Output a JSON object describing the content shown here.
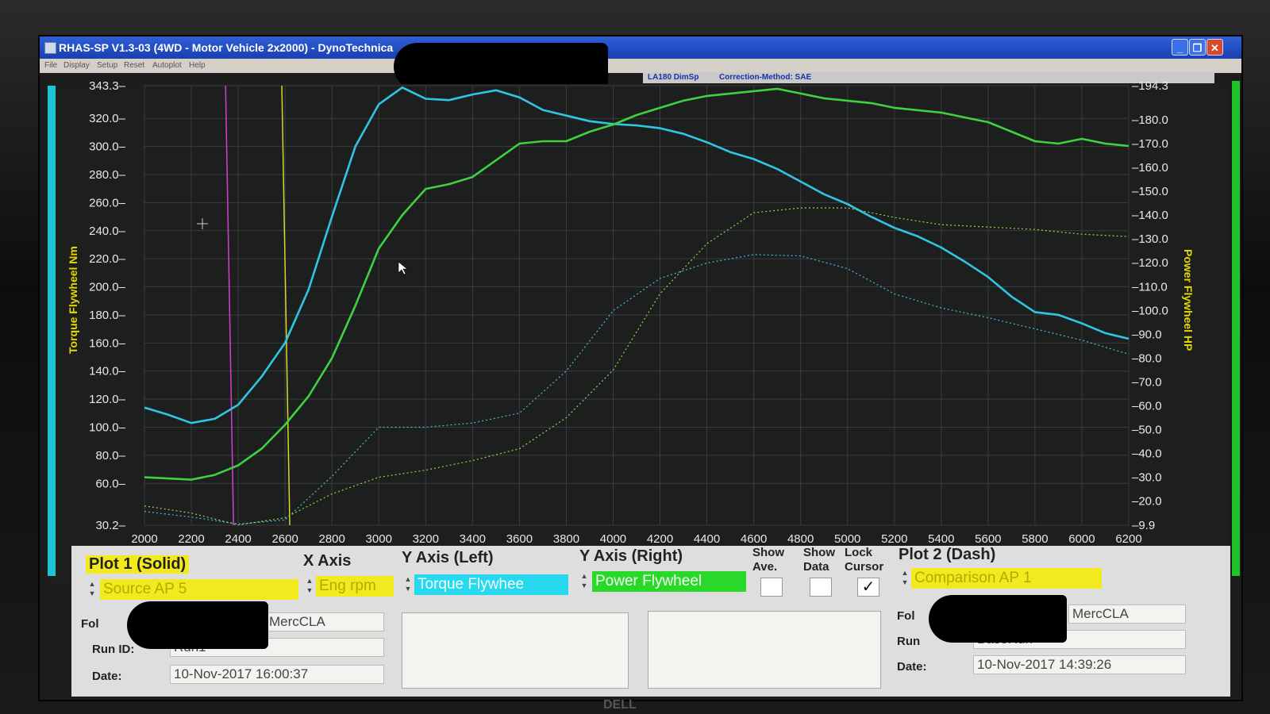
{
  "window": {
    "title": "RHAS-SP V1.3-03  (4WD - Motor Vehicle 2x2000) - DynoTechnica",
    "buttons": {
      "minimize": "_",
      "maximize": "❐",
      "close": "✕"
    }
  },
  "menu": [
    "File",
    "Display",
    "Setup",
    "Reset",
    "Autoplot",
    "Help"
  ],
  "info": {
    "dim": "LA180 DimSp",
    "correction": "Correction-Method: SAE"
  },
  "axes": {
    "left_label": "Torque Flywheel Nm",
    "right_label": "Power Flywheel HP",
    "left_ticks": [
      "343.3",
      "320.0",
      "300.0",
      "280.0",
      "260.0",
      "240.0",
      "220.0",
      "200.0",
      "180.0",
      "160.0",
      "140.0",
      "120.0",
      "100.0",
      "80.0",
      "60.0",
      "30.2"
    ],
    "left_values": [
      343.3,
      320,
      300,
      280,
      260,
      240,
      220,
      200,
      180,
      160,
      140,
      120,
      100,
      80,
      60,
      30.2
    ],
    "right_ticks": [
      "194.3",
      "180.0",
      "170.0",
      "160.0",
      "150.0",
      "140.0",
      "130.0",
      "120.0",
      "110.0",
      "100.0",
      "90.0",
      "80.0",
      "70.0",
      "60.0",
      "50.0",
      "40.0",
      "30.0",
      "20.0",
      "9.9"
    ],
    "right_values": [
      194.3,
      180,
      170,
      160,
      150,
      140,
      130,
      120,
      110,
      100,
      90,
      80,
      70,
      60,
      50,
      40,
      30,
      20,
      9.9
    ],
    "x_ticks": [
      "2000",
      "2200",
      "2400",
      "2600",
      "2800",
      "3000",
      "3200",
      "3400",
      "3600",
      "3800",
      "4000",
      "4200",
      "4400",
      "4600",
      "4800",
      "5000",
      "5200",
      "5400",
      "5600",
      "5800",
      "6000",
      "6200"
    ]
  },
  "chart_data": {
    "type": "line",
    "xlabel": "",
    "ylabel": "Torque Flywheel Nm",
    "ylabel_right": "Power Flywheel HP",
    "xlim": [
      2000,
      6200
    ],
    "ylim": [
      30.2,
      343.3
    ],
    "ylim_right": [
      9.9,
      194.3
    ],
    "grid": true,
    "markers": [
      {
        "x": 2380,
        "color": "#d43fd4"
      },
      {
        "x": 2620,
        "color": "#d8d820"
      }
    ],
    "series": [
      {
        "axis": "left",
        "style": "solid",
        "color": "#2fc6e2",
        "x": [
          2000,
          2100,
          2200,
          2300,
          2400,
          2500,
          2600,
          2700,
          2800,
          2900,
          3000,
          3100,
          3200,
          3300,
          3400,
          3500,
          3600,
          3700,
          3800,
          3900,
          4000,
          4100,
          4200,
          4300,
          4400,
          4500,
          4600,
          4700,
          4800,
          4900,
          5000,
          5100,
          5200,
          5300,
          5400,
          5500,
          5600,
          5700,
          5800,
          5900,
          6000,
          6100,
          6200
        ],
        "y": [
          114,
          109,
          103,
          106,
          116,
          136,
          160,
          198,
          250,
          300,
          330,
          342,
          334,
          333,
          337,
          340,
          335,
          326,
          322,
          318,
          316,
          315,
          313,
          309,
          303,
          296,
          291,
          284,
          275,
          266,
          259,
          250,
          242,
          236,
          228,
          218,
          207,
          193,
          182,
          180,
          174,
          167,
          163
        ]
      },
      {
        "axis": "right",
        "style": "solid",
        "color": "#3fd23f",
        "x": [
          2000,
          2100,
          2200,
          2300,
          2400,
          2500,
          2600,
          2700,
          2800,
          2900,
          3000,
          3100,
          3200,
          3300,
          3400,
          3500,
          3600,
          3700,
          3800,
          3900,
          4000,
          4100,
          4200,
          4300,
          4400,
          4500,
          4600,
          4700,
          4800,
          4900,
          5000,
          5100,
          5200,
          5300,
          5400,
          5500,
          5600,
          5700,
          5800,
          5900,
          6000,
          6100,
          6200
        ],
        "y": [
          30,
          29.5,
          29,
          31,
          35,
          42,
          52,
          64,
          80,
          102,
          126,
          140,
          151,
          153,
          156,
          163,
          170,
          171,
          171,
          175,
          178,
          182,
          185,
          188,
          190,
          191,
          192,
          193,
          191,
          189,
          188,
          187,
          185,
          184,
          183,
          181,
          179,
          175,
          171,
          170,
          172,
          170,
          169
        ]
      },
      {
        "axis": "left",
        "style": "dotted",
        "color": "#3fbfe0",
        "x": [
          2000,
          2200,
          2400,
          2600,
          2800,
          3000,
          3200,
          3400,
          3600,
          3800,
          4000,
          4200,
          4400,
          4600,
          4800,
          5000,
          5200,
          5400,
          5600,
          5800,
          6000,
          6200
        ],
        "y": [
          40,
          36,
          31,
          34,
          65,
          100,
          100,
          103,
          110,
          140,
          183,
          206,
          217,
          223,
          222,
          213,
          195,
          185,
          178,
          170,
          162,
          152
        ]
      },
      {
        "axis": "right",
        "style": "dotted",
        "color": "#9ad24a",
        "x": [
          2000,
          2200,
          2400,
          2600,
          2800,
          3000,
          3200,
          3400,
          3600,
          3800,
          4000,
          4200,
          4400,
          4600,
          4800,
          5000,
          5200,
          5400,
          5600,
          5800,
          6000,
          6200
        ],
        "y": [
          18,
          15,
          10,
          13,
          23,
          30,
          33,
          37,
          42,
          55,
          75,
          107,
          128,
          141,
          143,
          143,
          139,
          136,
          135,
          134,
          132,
          131
        ]
      }
    ]
  },
  "controls": {
    "plot1": {
      "header": "Plot 1 (Solid)",
      "source": "Source AP 5",
      "folder_label": "Fol",
      "folder": "MercCLA",
      "run_label": "Run ID:",
      "run": "Run1",
      "date_label": "Date:",
      "date": "10-Nov-2017  16:00:37"
    },
    "x_axis": {
      "header": "X Axis",
      "value": "Eng rpm"
    },
    "y_left": {
      "header": "Y Axis (Left)",
      "value": "Torque Flywhee"
    },
    "y_right": {
      "header": "Y Axis (Right)",
      "value": "Power Flywheel"
    },
    "show_ave": {
      "label1": "Show",
      "label2": "Ave.",
      "checked": false
    },
    "show_data": {
      "label1": "Show",
      "label2": "Data",
      "checked": false
    },
    "lock_cursor": {
      "label1": "Lock",
      "label2": "Cursor",
      "checked": true,
      "mark": "✓"
    },
    "plot2": {
      "header": "Plot 2 (Dash)",
      "source": "Comparison AP 1",
      "folder_label": "Fol",
      "folder": "MercCLA",
      "run_label": "Run",
      "run": "BaseRun",
      "date_label": "Date:",
      "date": "10-Nov-2017  14:39:26"
    }
  },
  "colors": {
    "torque": "#2fc6e2",
    "power": "#3fd23f",
    "label": "#e6d800",
    "highlight_yellow": "#f2ea1f",
    "highlight_cyan": "#27d8ee",
    "highlight_green": "#2ad82a"
  },
  "brand": "DELL"
}
